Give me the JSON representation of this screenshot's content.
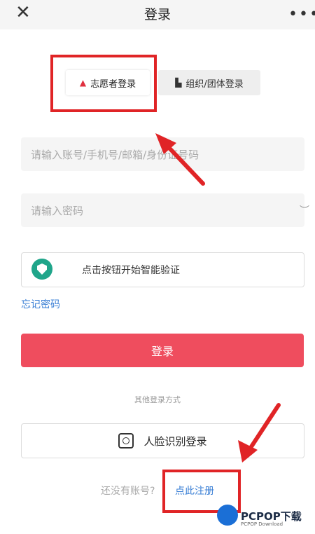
{
  "header": {
    "close_icon": "close-icon",
    "title": "登录",
    "more_icon": "more-icon"
  },
  "tabs": [
    {
      "label": "志愿者登录",
      "icon": "person-icon",
      "selected": true
    },
    {
      "label": "组织/团体登录",
      "icon": "building-icon",
      "selected": false
    }
  ],
  "form": {
    "account_placeholder": "请输入账号/手机号/邮箱/身份证号码",
    "password_placeholder": "请输入密码",
    "verify_label": "点击按钮开始智能验证",
    "forgot_label": "忘记密码",
    "login_label": "登录"
  },
  "alt_login": {
    "divider_text": "其他登录方式",
    "face_label": "人脸识别登录"
  },
  "register": {
    "hint": "还没有账号?",
    "link": "点此注册"
  },
  "watermark": {
    "brand": "PCPOP下载",
    "sub": "PCPOP Download"
  },
  "colors": {
    "accent": "#ef4d5e",
    "link": "#3a7fd5",
    "annotation": "#e02426"
  }
}
